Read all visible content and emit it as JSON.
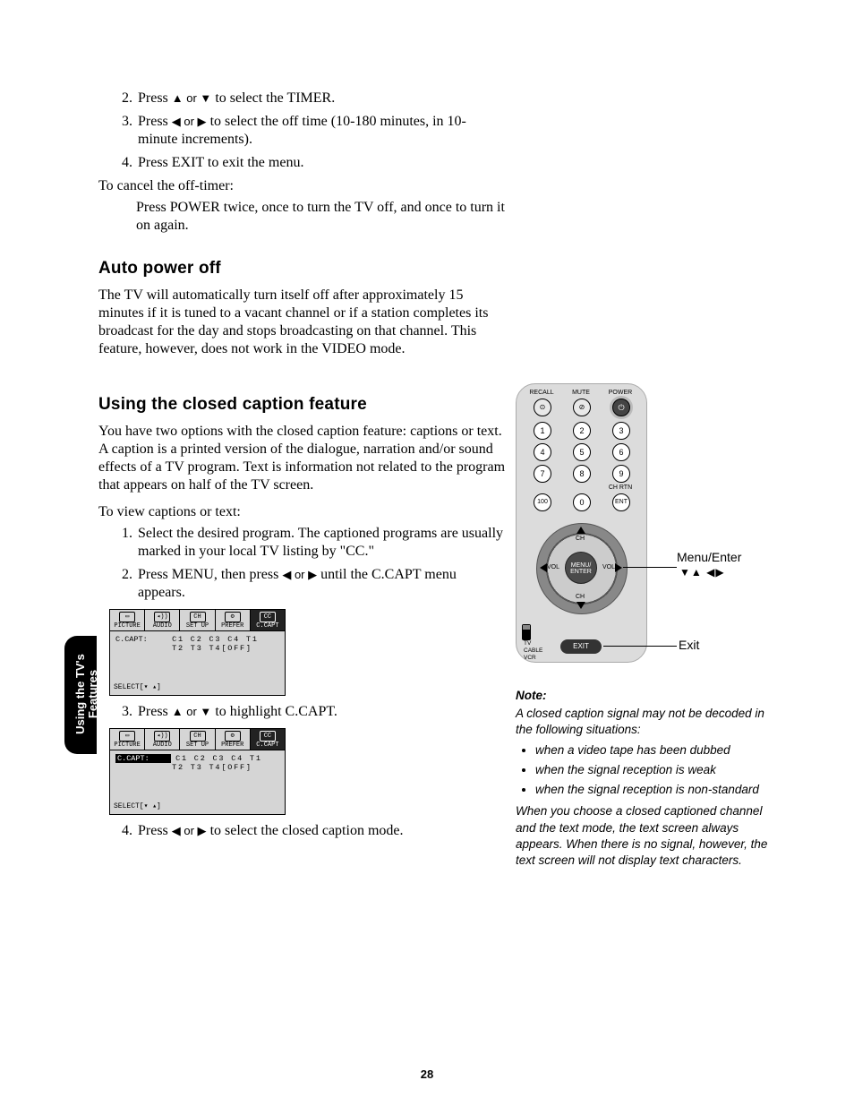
{
  "sideTab": {
    "line1": "Using the TV's",
    "line2": "Features"
  },
  "steps_top": [
    {
      "num": 2,
      "pre": "Press ",
      "sym": "▲ or ▼",
      "post": " to select the TIMER."
    },
    {
      "num": 3,
      "pre": "Press ",
      "sym": "◀ or ▶",
      "post": " to select the off time (10-180 minutes, in 10-minute increments)."
    },
    {
      "num": 4,
      "text": "Press EXIT to exit the menu."
    }
  ],
  "cancel_intro": "To cancel the off-timer:",
  "cancel_body": "Press POWER twice, once to turn the TV off, and once to turn it on again.",
  "sec1_title": "Auto power off",
  "sec1_body": "The TV will automatically turn itself off after approximately 15 minutes if it is tuned to a vacant channel or if a station completes its broadcast for the day and stops broadcasting on that channel. This feature, however, does not work in the VIDEO mode.",
  "sec2_title": "Using the closed caption feature",
  "sec2_p1": "You have two options with the closed caption feature: captions or text. A caption is a printed version of the dialogue, narration and/or sound effects of a TV program. Text is information not related to the program that appears on half of the TV screen.",
  "sec2_p2": "To view captions or text:",
  "sec2_steps_a": [
    {
      "num": 1,
      "text": "Select the desired program. The captioned programs are usually marked in your local TV listing by \"CC.\""
    },
    {
      "num": 2,
      "pre": "Press MENU, then press ",
      "sym": "◀ or ▶",
      "post": " until the C.CAPT menu appears."
    }
  ],
  "sec2_step3": {
    "pre": "Press ",
    "sym": "▲ or ▼",
    "post": " to highlight C.CAPT."
  },
  "sec2_step4": {
    "pre": "Press ",
    "sym": "◀ or ▶",
    "post": " to select the closed caption mode."
  },
  "osd": {
    "tabs": [
      {
        "label": "PICTURE",
        "glyph": "▭"
      },
      {
        "label": "AUDIO",
        "glyph": "◂))"
      },
      {
        "label": "SET UP",
        "glyph": "CH"
      },
      {
        "label": "PREFER",
        "glyph": "⚙"
      },
      {
        "label": "C.CAPT",
        "glyph": "CC",
        "active": true
      }
    ],
    "row_label": "C.CAPT:",
    "opts_line1": "C1 C2 C3 C4 T1",
    "opts_line2": "T2 T3 T4[OFF]",
    "footer": "SELECT[▾ ▴]"
  },
  "remote": {
    "top_labels": [
      "RECALL",
      "MUTE",
      "POWER"
    ],
    "keypad": [
      "1",
      "2",
      "3",
      "4",
      "5",
      "6",
      "7",
      "8",
      "9",
      "100",
      "0",
      "ENT"
    ],
    "chrtn": "CH RTN",
    "dpad_center": "MENU/\nENTER",
    "dpad_ch": "CH",
    "dpad_vol": "VOL",
    "switch": [
      "TV",
      "CABLE",
      "VCR"
    ],
    "exit": "EXIT"
  },
  "callouts": {
    "menu": "Menu/Enter",
    "menu_syms": "▼▲  ◀▶",
    "exit": "Exit"
  },
  "note": {
    "title": "Note:",
    "intro": "A closed caption signal may not be decoded in the following situations:",
    "bullets": [
      "when a video tape has been dubbed",
      "when the signal reception is weak",
      "when the signal reception is non-standard"
    ],
    "outro": "When you choose a closed captioned channel and the text mode, the text screen always appears. When there is no signal, however, the text screen will not display text characters."
  },
  "page_number": "28"
}
